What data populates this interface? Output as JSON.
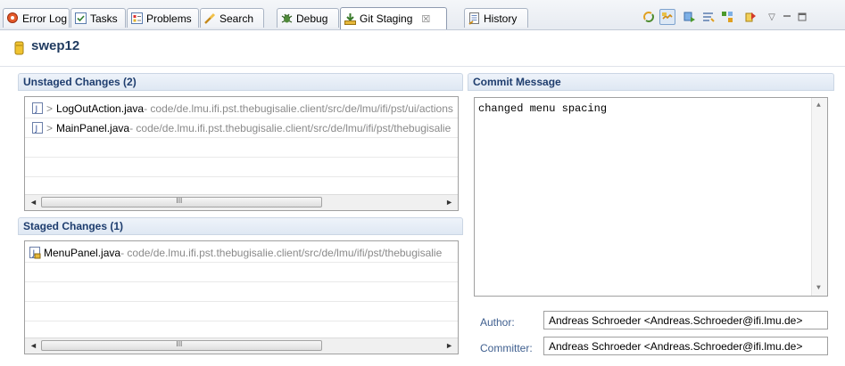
{
  "tabs": [
    {
      "label": "Error Log",
      "icon": "error-log-icon"
    },
    {
      "label": "Tasks",
      "icon": "tasks-icon"
    },
    {
      "label": "Problems",
      "icon": "problems-icon"
    },
    {
      "label": "Search",
      "icon": "search-icon"
    },
    {
      "label": "Debug",
      "icon": "debug-icon"
    },
    {
      "label": "Git Staging",
      "icon": "git-staging-icon",
      "active": true
    },
    {
      "label": "History",
      "icon": "history-icon"
    }
  ],
  "tab_close_glyph": "☒",
  "repo": {
    "name": "swep12"
  },
  "unstaged": {
    "header": "Unstaged Changes (2)",
    "items": [
      {
        "prefix": ">",
        "name": "LogOutAction.java",
        "path": " - code/de.lmu.ifi.pst.thebugisalie.client/src/de/lmu/ifi/pst/ui/actions"
      },
      {
        "prefix": ">",
        "name": "MainPanel.java",
        "path": " - code/de.lmu.ifi.pst.thebugisalie.client/src/de/lmu/ifi/pst/thebugisalie"
      }
    ]
  },
  "staged": {
    "header": "Staged Changes (1)",
    "items": [
      {
        "prefix": "",
        "name": "MenuPanel.java",
        "path": " - code/de.lmu.ifi.pst.thebugisalie.client/src/de/lmu/ifi/pst/thebugisalie"
      }
    ]
  },
  "commit": {
    "header": "Commit Message",
    "message": "changed menu spacing",
    "author_label": "Author:",
    "author": "Andreas Schroeder <Andreas.Schroeder@ifi.lmu.de>",
    "committer_label": "Committer:",
    "committer": "Andreas Schroeder <Andreas.Schroeder@ifi.lmu.de>"
  },
  "scroll": {
    "left": "◄",
    "right": "►",
    "grip": "III",
    "up": "▲",
    "down": "▼"
  }
}
